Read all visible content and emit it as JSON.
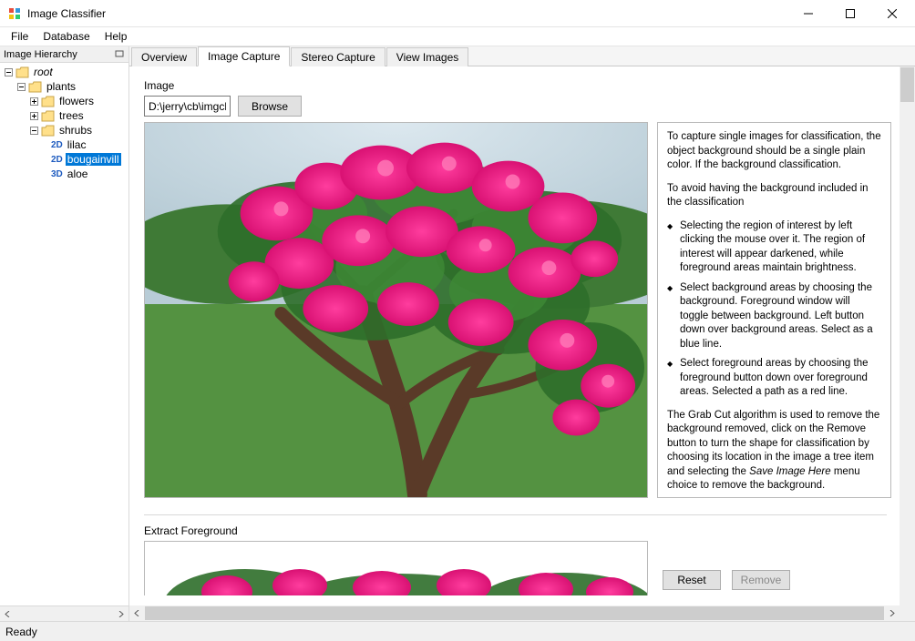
{
  "window": {
    "title": "Image Classifier",
    "controls": {
      "min": "minimize",
      "max": "maximize",
      "close": "close"
    }
  },
  "menubar": {
    "items": [
      "File",
      "Database",
      "Help"
    ]
  },
  "sidebar": {
    "title": "Image Hierarchy",
    "tree": {
      "root": {
        "label": "root",
        "expanded": true
      },
      "plants": {
        "label": "plants",
        "expanded": true
      },
      "flowers": {
        "label": "flowers",
        "expanded": false
      },
      "trees": {
        "label": "trees",
        "expanded": false
      },
      "shrubs": {
        "label": "shrubs",
        "expanded": true
      },
      "lilac": {
        "label": "lilac",
        "badge": "2D"
      },
      "bougainvillea": {
        "label": "bougainvill",
        "badge": "2D",
        "selected": true
      },
      "aloe": {
        "label": "aloe",
        "badge": "3D"
      }
    }
  },
  "tabs": {
    "items": [
      "Overview",
      "Image Capture",
      "Stereo Capture",
      "View Images"
    ],
    "active": 1
  },
  "capture": {
    "image_label": "Image",
    "path_value": "D:\\jerry\\cb\\imgcls\\",
    "browse_label": "Browse",
    "extract_label": "Extract Foreground",
    "reset_label": "Reset",
    "remove_label": "Remove"
  },
  "help": {
    "p1": "To capture single images for classification, the object background should be a single plain color. If the background classification.",
    "p2": "To avoid having the background included in the classification",
    "b1": "Selecting the region of interest by left clicking the mouse over it. The region of interest will appear darkened, while foreground areas maintain brightness.",
    "b2": "Select background areas by choosing the background. Foreground window will toggle between background. Left button down over background areas. Select as a blue line.",
    "b3": "Select foreground areas by choosing the foreground button down over foreground areas. Selected a path as a red line.",
    "p3a": "The Grab Cut algorithm is used to remove the background removed, click on the Remove button to turn the shape for classification by choosing its location in the image a tree item and selecting the ",
    "p3i": "Save Image Here",
    "p3b": " menu choice to remove the background."
  },
  "statusbar": {
    "text": "Ready"
  }
}
